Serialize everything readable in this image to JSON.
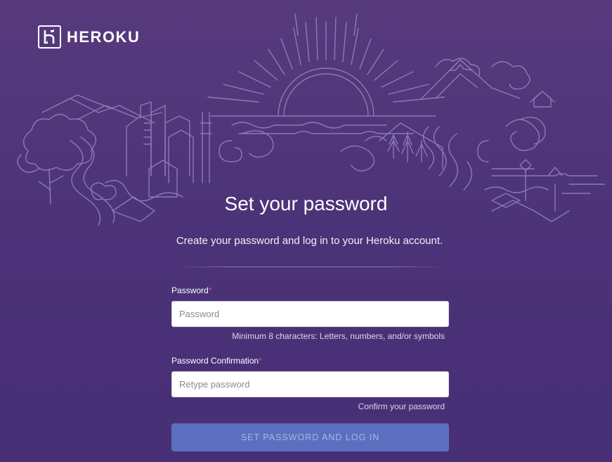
{
  "brand": {
    "name": "HEROKU",
    "logo_icon": "heroku-logo-icon"
  },
  "page": {
    "title": "Set your password",
    "subtitle": "Create your password and log in to your Heroku account."
  },
  "form": {
    "password": {
      "label": "Password",
      "required_marker": "*",
      "placeholder": "Password",
      "value": "",
      "hint": "Minimum 8 characters: Letters, numbers, and/or symbols"
    },
    "password_confirmation": {
      "label": "Password Confirmation",
      "required_marker": "*",
      "placeholder": "Retype password",
      "value": "",
      "hint": "Confirm your password"
    },
    "submit_label": "SET PASSWORD AND LOG IN"
  },
  "colors": {
    "background_top": "#573a7d",
    "background_bottom": "#472f76",
    "illustration_line": "#8c79b8",
    "button": "#5c6fbf",
    "required": "#e8506b"
  }
}
